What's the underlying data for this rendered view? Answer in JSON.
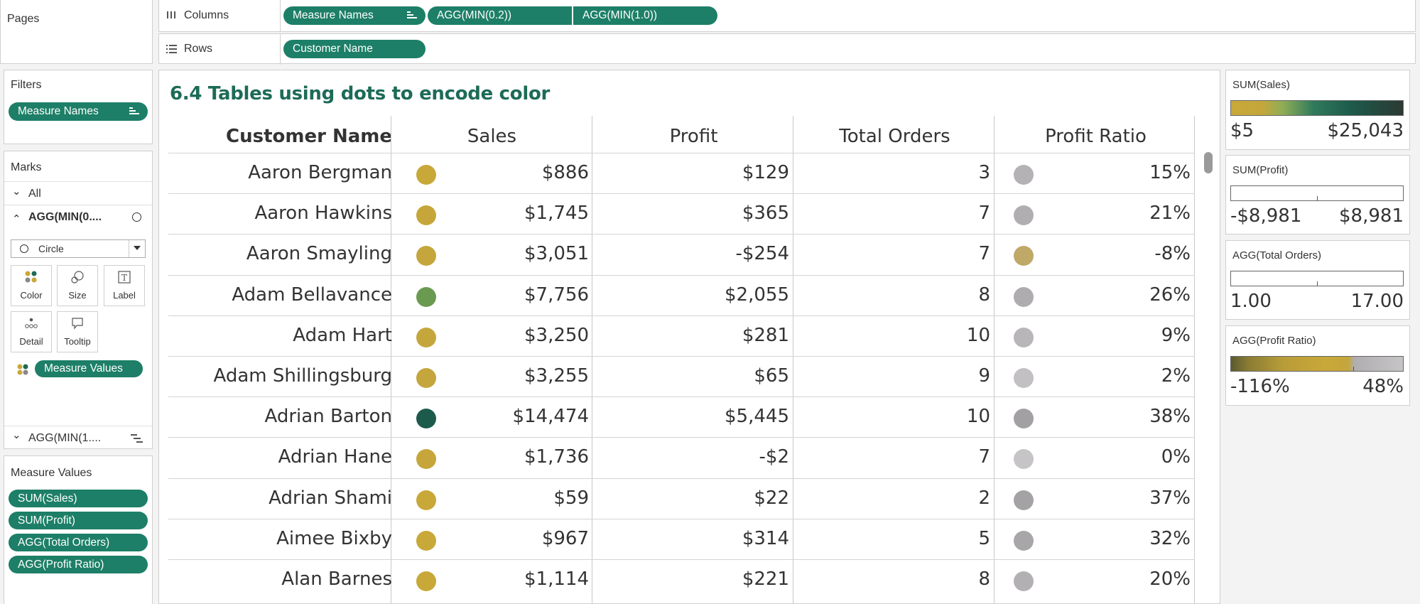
{
  "shelves": {
    "pages_title": "Pages",
    "columns_label": "Columns",
    "rows_label": "Rows",
    "columns_pills": [
      "Measure Names",
      "AGG(MIN(0.2))",
      "AGG(MIN(1.0))"
    ],
    "rows_pills": [
      "Customer Name"
    ]
  },
  "filters": {
    "title": "Filters",
    "pill": "Measure Names"
  },
  "marks": {
    "title": "Marks",
    "all_label": "All",
    "layer1_label": "AGG(MIN(0....",
    "mark_type": "Circle",
    "buttons": [
      "Color",
      "Size",
      "Label",
      "Detail",
      "Tooltip"
    ],
    "color_pill": "Measure Values",
    "layer2_label": "AGG(MIN(1...."
  },
  "measure_values": {
    "title": "Measure Values",
    "pills": [
      "SUM(Sales)",
      "SUM(Profit)",
      "AGG(Total Orders)",
      "AGG(Profit Ratio)"
    ]
  },
  "view": {
    "title": "6.4 Tables using dots to encode color",
    "headers": [
      "Customer Name",
      "Sales",
      "Profit",
      "Total Orders",
      "Profit Ratio"
    ],
    "rows": [
      {
        "name": "Aaron Bergman",
        "sales": "$886",
        "profit": "$129",
        "orders": "3",
        "ratio": "15%",
        "sales_color": "#c8a838",
        "ratio_color": "#b4b2b4"
      },
      {
        "name": "Aaron Hawkins",
        "sales": "$1,745",
        "profit": "$365",
        "orders": "7",
        "ratio": "21%",
        "sales_color": "#c6a63a",
        "ratio_color": "#b0aeb0"
      },
      {
        "name": "Aaron Smayling",
        "sales": "$3,051",
        "profit": "-$254",
        "orders": "7",
        "ratio": "-8%",
        "sales_color": "#c4a63c",
        "ratio_color": "#c0a868"
      },
      {
        "name": "Adam Bellavance",
        "sales": "$7,756",
        "profit": "$2,055",
        "orders": "8",
        "ratio": "26%",
        "sales_color": "#6a9a50",
        "ratio_color": "#aeacae"
      },
      {
        "name": "Adam Hart",
        "sales": "$3,250",
        "profit": "$281",
        "orders": "10",
        "ratio": "9%",
        "sales_color": "#c4a63c",
        "ratio_color": "#b8b6b8"
      },
      {
        "name": "Adam Shillingsburg",
        "sales": "$3,255",
        "profit": "$65",
        "orders": "9",
        "ratio": "2%",
        "sales_color": "#c4a63c",
        "ratio_color": "#c2c0c2"
      },
      {
        "name": "Adrian Barton",
        "sales": "$14,474",
        "profit": "$5,445",
        "orders": "10",
        "ratio": "38%",
        "sales_color": "#1c5a4c",
        "ratio_color": "#a2a0a2"
      },
      {
        "name": "Adrian Hane",
        "sales": "$1,736",
        "profit": "-$2",
        "orders": "7",
        "ratio": "0%",
        "sales_color": "#c6a63a",
        "ratio_color": "#c6c4c6"
      },
      {
        "name": "Adrian Shami",
        "sales": "$59",
        "profit": "$22",
        "orders": "2",
        "ratio": "37%",
        "sales_color": "#c8a838",
        "ratio_color": "#a4a2a4"
      },
      {
        "name": "Aimee Bixby",
        "sales": "$967",
        "profit": "$314",
        "orders": "5",
        "ratio": "32%",
        "sales_color": "#c8a838",
        "ratio_color": "#a8a6a8"
      },
      {
        "name": "Alan Barnes",
        "sales": "$1,114",
        "profit": "$221",
        "orders": "8",
        "ratio": "20%",
        "sales_color": "#c8a838",
        "ratio_color": "#b2b0b2"
      }
    ]
  },
  "legends": [
    {
      "title": "SUM(Sales)",
      "lo": "$5",
      "hi": "$25,043",
      "kind": "sales"
    },
    {
      "title": "SUM(Profit)",
      "lo": "-$8,981",
      "hi": "$8,981",
      "kind": "blank"
    },
    {
      "title": "AGG(Total Orders)",
      "lo": "1.00",
      "hi": "17.00",
      "kind": "blank"
    },
    {
      "title": "AGG(Profit Ratio)",
      "lo": "-116%",
      "hi": "48%",
      "kind": "ratio"
    }
  ],
  "colors": {
    "pill": "#1d7f67",
    "title": "#1d6b57"
  }
}
